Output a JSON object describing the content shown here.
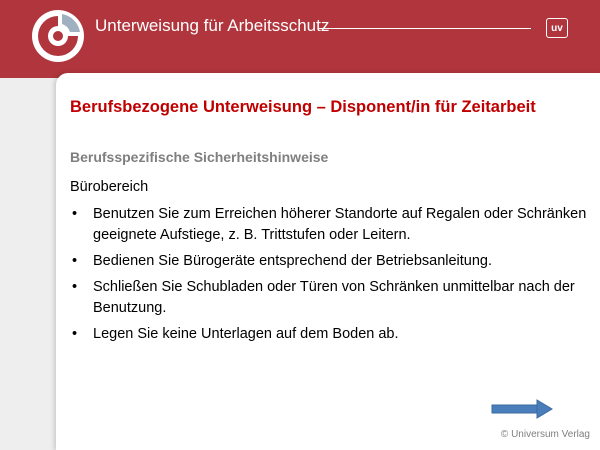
{
  "header": {
    "title": "Unterweisung für Arbeitsschutz",
    "badge": "uv"
  },
  "slide": {
    "title": "Berufsbezogene Unterweisung – Disponent/in für Zeitarbeit",
    "section_heading": "Berufsspezifische Sicherheitshinweise",
    "subheading": "Bürobereich",
    "bullets": [
      "Benutzen Sie zum Erreichen höherer Standorte auf Regalen oder Schränken geeignete Aufstiege, z. B. Trittstufen oder Leitern.",
      "Bedienen Sie Bürogeräte entsprechend der Betriebsanleitung.",
      "Schließen Sie Schubladen oder Türen von Schränken unmittelbar nach der Benutzung.",
      "Legen Sie keine Unterlagen auf dem Boden ab."
    ],
    "copyright": "© Universum Verlag"
  },
  "colors": {
    "header_bg": "#b0353c",
    "title_red": "#c00000",
    "heading_gray": "#7f7f7f",
    "arrow_blue": "#4a7ebb"
  },
  "icons": {
    "logo": "circle-logo-icon",
    "next": "arrow-right-icon"
  }
}
